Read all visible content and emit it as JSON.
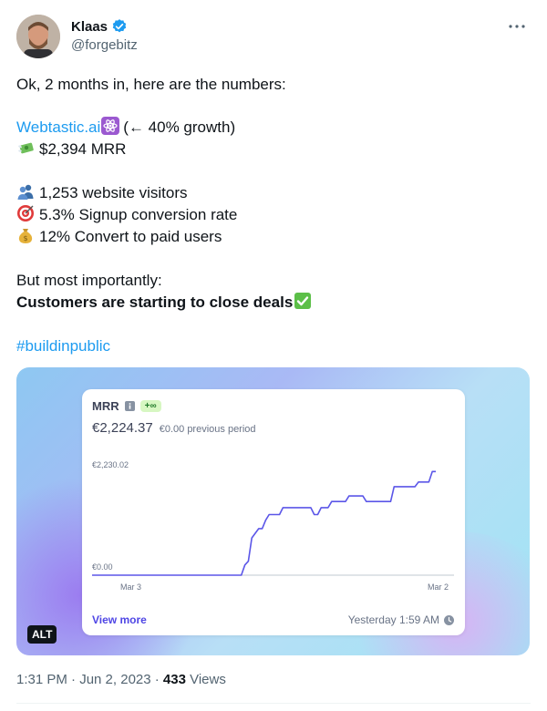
{
  "author": {
    "name": "Klaas",
    "handle": "@forgebitz",
    "verified_color": "#1d9bf0"
  },
  "tweet": {
    "line1": "Ok, 2 months in, here are the numbers:",
    "link": "Webtastic.ai",
    "growth": "(← 40% growth)",
    "mrr_line": "$2,394  MRR",
    "visitors": "1,253 website visitors",
    "conversion": "5.3% Signup conversion rate",
    "paid": "12% Convert to paid users",
    "important": "But most importantly:",
    "closing": "Customers are starting to close deals",
    "hashtag": "#buildinpublic"
  },
  "media": {
    "card_title": "MRR",
    "badge": "+∞",
    "value": "€2,224.37",
    "previous": "€0.00 previous period",
    "view_more": "View more",
    "timestamp": "Yesterday 1:59 AM",
    "alt": "ALT"
  },
  "chart_data": {
    "type": "line",
    "title": "MRR",
    "ytick_labels": [
      "€2,230.02",
      "€0.00"
    ],
    "xtick_labels": [
      "Mar 3",
      "Mar 2"
    ],
    "ylim": [
      0,
      2230.02
    ],
    "x": [
      0,
      1,
      2,
      3,
      4,
      5,
      6,
      7,
      8,
      9,
      10,
      11,
      12,
      13,
      14,
      15,
      16,
      17,
      18,
      19,
      20,
      21,
      22,
      23,
      24,
      25,
      26,
      27,
      28,
      29,
      30,
      31,
      32,
      33,
      34,
      35,
      36,
      37,
      38,
      39,
      40,
      41,
      42,
      43,
      44,
      45,
      46,
      47,
      48,
      49,
      50,
      51,
      52,
      53,
      54,
      55,
      56,
      57,
      58,
      59,
      60,
      61,
      62,
      63,
      64,
      65,
      66,
      67,
      68,
      69,
      70,
      71,
      72,
      73,
      74,
      75,
      76,
      77,
      78,
      79,
      80,
      81,
      82,
      83,
      84,
      85,
      86,
      87,
      88,
      89,
      90,
      91,
      92,
      93,
      94,
      95,
      96,
      97,
      98,
      99
    ],
    "values": [
      0,
      0,
      0,
      0,
      0,
      0,
      0,
      0,
      0,
      0,
      0,
      0,
      0,
      0,
      0,
      0,
      0,
      0,
      0,
      0,
      0,
      0,
      0,
      0,
      0,
      0,
      0,
      0,
      0,
      0,
      0,
      0,
      0,
      0,
      0,
      0,
      0,
      0,
      0,
      0,
      0,
      0,
      0,
      0,
      220,
      300,
      800,
      900,
      1000,
      1000,
      1180,
      1300,
      1300,
      1300,
      1300,
      1450,
      1450,
      1450,
      1450,
      1450,
      1450,
      1450,
      1450,
      1450,
      1300,
      1300,
      1450,
      1450,
      1450,
      1580,
      1580,
      1580,
      1580,
      1580,
      1700,
      1700,
      1700,
      1700,
      1700,
      1580,
      1580,
      1580,
      1580,
      1580,
      1580,
      1580,
      1580,
      1900,
      1900,
      1900,
      1900,
      1900,
      1900,
      1900,
      2000,
      2000,
      2000,
      2000,
      2224,
      2224
    ],
    "grid": false,
    "line_color": "#5b56e8"
  },
  "footer": {
    "time": "1:31 PM · Jun 2, 2023 · ",
    "views_count": "433",
    "views_label": " Views"
  },
  "colors": {
    "link": "#1d9bf0",
    "muted": "#536471",
    "card_link": "#4f46e5"
  }
}
